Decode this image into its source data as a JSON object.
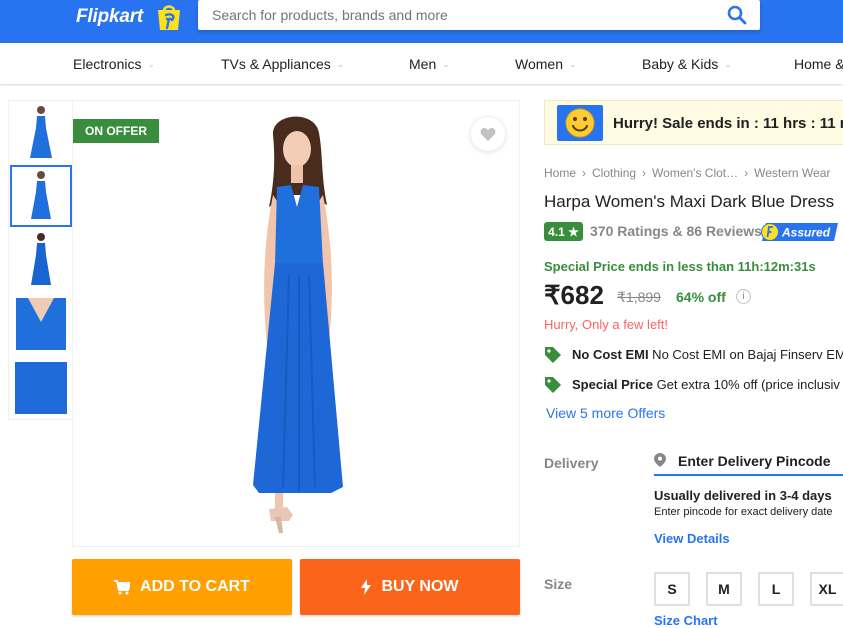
{
  "header": {
    "logo": "Flipkart",
    "search_placeholder": "Search for products, brands and more"
  },
  "nav": {
    "items": [
      "Electronics",
      "TVs & Appliances",
      "Men",
      "Women",
      "Baby & Kids",
      "Home &"
    ]
  },
  "gallery": {
    "offer_tag": "ON OFFER",
    "thumbnail_count": 5,
    "active_thumbnail": 2
  },
  "actions": {
    "add_to_cart": "ADD TO CART",
    "buy_now": "BUY NOW"
  },
  "sale_banner": {
    "text": "Hurry! Sale ends in : 11 hrs : 11 m"
  },
  "breadcrumb": [
    "Home",
    "Clothing",
    "Women's Clot…",
    "Western Wear"
  ],
  "product": {
    "title": "Harpa Women's Maxi Dark Blue Dress",
    "rating": "4.1 ★",
    "rating_count": "370 Ratings & 86 Reviews",
    "assured_label": "Assured",
    "special_price_note": "Special Price ends in less than 11h:12m:31s",
    "price": "₹682",
    "mrp": "₹1,899",
    "discount": "64% off",
    "info_icon": "i",
    "stock_note": "Hurry, Only a few left!"
  },
  "offers": [
    {
      "bold": "No Cost EMI",
      "text": " No Cost EMI on Bajaj Finserv EM"
    },
    {
      "bold": "Special Price",
      "text": " Get extra 10% off (price inclusiv"
    }
  ],
  "view_more_offers": "View 5 more Offers",
  "delivery": {
    "label": "Delivery",
    "pincode_placeholder": "Enter Delivery Pincode",
    "main": "Usually delivered in 3-4 days",
    "sub": "Enter pincode for exact delivery date",
    "view_details": "View Details"
  },
  "size": {
    "label": "Size",
    "options": [
      "S",
      "M",
      "L",
      "XL"
    ],
    "chart_link": "Size Chart"
  },
  "colors": {
    "brand_blue": "#2874f0",
    "cart_orange": "#ff9f00",
    "buy_orange": "#fb641b",
    "green": "#388e3c",
    "dress_blue": "#1f6fdc"
  }
}
